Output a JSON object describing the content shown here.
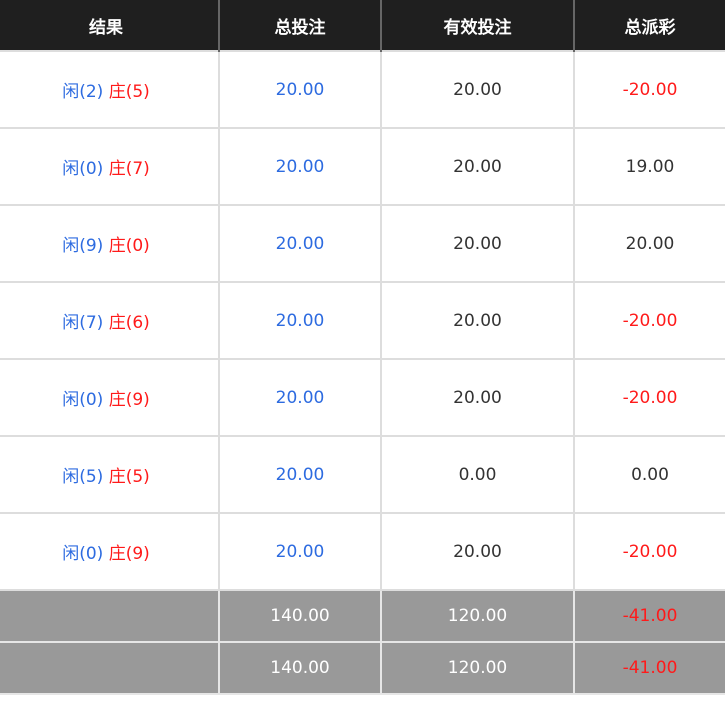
{
  "headers": [
    "结果",
    "总投注",
    "有效投注",
    "总派彩"
  ],
  "colors": {
    "player": "#2d6be0",
    "banker": "#ff1a1a",
    "header_bg": "#1f1f1f",
    "summary_bg": "#999999"
  },
  "rows": [
    {
      "player": "闲(2)",
      "banker": "庄(5)",
      "total_bet": "20.00",
      "valid_bet": "20.00",
      "payout": "-20.00",
      "payout_negative": true
    },
    {
      "player": "闲(0)",
      "banker": "庄(7)",
      "total_bet": "20.00",
      "valid_bet": "20.00",
      "payout": "19.00",
      "payout_negative": false
    },
    {
      "player": "闲(9)",
      "banker": "庄(0)",
      "total_bet": "20.00",
      "valid_bet": "20.00",
      "payout": "20.00",
      "payout_negative": false
    },
    {
      "player": "闲(7)",
      "banker": "庄(6)",
      "total_bet": "20.00",
      "valid_bet": "20.00",
      "payout": "-20.00",
      "payout_negative": true
    },
    {
      "player": "闲(0)",
      "banker": "庄(9)",
      "total_bet": "20.00",
      "valid_bet": "20.00",
      "payout": "-20.00",
      "payout_negative": true
    },
    {
      "player": "闲(5)",
      "banker": "庄(5)",
      "total_bet": "20.00",
      "valid_bet": "0.00",
      "payout": "0.00",
      "payout_negative": false
    },
    {
      "player": "闲(0)",
      "banker": "庄(9)",
      "total_bet": "20.00",
      "valid_bet": "20.00",
      "payout": "-20.00",
      "payout_negative": true
    }
  ],
  "summary": [
    {
      "label": "",
      "total_bet": "140.00",
      "valid_bet": "120.00",
      "payout": "-41.00"
    },
    {
      "label": "",
      "total_bet": "140.00",
      "valid_bet": "120.00",
      "payout": "-41.00"
    }
  ]
}
